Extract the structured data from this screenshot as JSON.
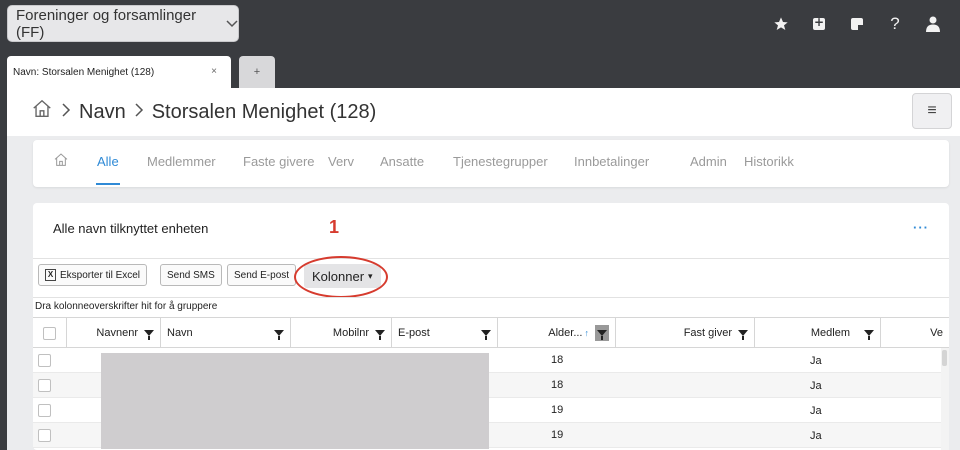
{
  "topbar": {
    "org_select": "Foreninger og forsamlinger (FF)",
    "icons": [
      "star-icon",
      "plus-square-icon",
      "note-icon",
      "help-icon",
      "user-icon"
    ],
    "help_glyph": "?"
  },
  "tabs": {
    "active_label": "Navn: Storsalen Menighet (128)",
    "close_glyph": "×",
    "new_tab_glyph": "+"
  },
  "header": {
    "crumbs": [
      "Navn",
      "Storsalen Menighet (128)"
    ],
    "menu_glyph": "≡"
  },
  "nav": {
    "items": [
      "Alle",
      "Medlemmer",
      "Faste givere",
      "Verv",
      "Ansatte",
      "Tjenestegrupper",
      "Innbetalinger",
      "Admin",
      "Historikk"
    ],
    "active": "Alle"
  },
  "card": {
    "title": "Alle navn tilknyttet enheten",
    "more_glyph": "···",
    "annotation_number": "1"
  },
  "toolbar": {
    "export_icon_glyph": "X",
    "export_label": "Eksporter til Excel",
    "sms_label": "Send SMS",
    "email_label": "Send E-post",
    "columns_label": "Kolonner",
    "columns_caret": "▾"
  },
  "grid": {
    "group_hint": "Dra kolonneoverskrifter hit for å gruppere",
    "columns": [
      "Navnenr",
      "Navn",
      "Mobilnr",
      "E-post",
      "Alder...",
      "Fast giver",
      "Medlem",
      "Ve"
    ],
    "sort_glyph": "↑",
    "rows": [
      {
        "alder": "18",
        "medlem": "Ja"
      },
      {
        "alder": "18",
        "medlem": "Ja"
      },
      {
        "alder": "19",
        "medlem": "Ja"
      },
      {
        "alder": "19",
        "medlem": "Ja"
      }
    ]
  },
  "colors": {
    "accent": "#2f8ad6",
    "annotation": "#d63b2e",
    "dark_bar": "#3a3c40"
  }
}
